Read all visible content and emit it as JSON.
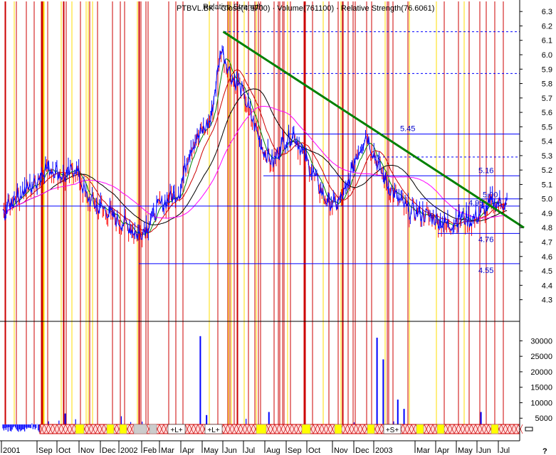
{
  "chart_data": {
    "type": "line",
    "title": "PTBVL.BK - Close(4.9700) · Volume(761100) · Relative Strength(76.6061)",
    "title_overlap_text": "Relative Strength",
    "x_labels": [
      "2001",
      "Sep",
      "Oct",
      "Nov",
      "Dec",
      "2002",
      "Feb",
      "Mar",
      "Apr",
      "May",
      "Jun",
      "Jul",
      "Aug",
      "Sep",
      "Oct",
      "Nov",
      "Dec",
      "2003",
      "Mar",
      "Apr",
      "May",
      "Jun",
      "Jul"
    ],
    "price_axis": {
      "ylim": [
        4.15,
        6.37
      ],
      "ticks": [
        "6.3",
        "6.2",
        "6.1",
        "6.0",
        "5.9",
        "5.8",
        "5.7",
        "5.6",
        "5.5",
        "5.4",
        "5.3",
        "5.2",
        "5.1",
        "5.0",
        "4.9",
        "4.8",
        "4.7",
        "4.6",
        "4.5",
        "4.4",
        "4.3"
      ]
    },
    "volume_axis": {
      "ylim": [
        0,
        34000
      ],
      "ticks": [
        "30000",
        "25000",
        "20000",
        "15000",
        "10000",
        "5000"
      ]
    },
    "grid": false,
    "legend": "none",
    "level_lines": [
      {
        "label": "5.45",
        "value": 5.45
      },
      {
        "label": "5.16",
        "value": 5.16
      },
      {
        "label": "5.00",
        "value": 5.0
      },
      {
        "label": "4.95",
        "value": 4.95
      },
      {
        "label": "4.76",
        "value": 4.76
      },
      {
        "label": "4.55",
        "value": 4.55
      }
    ],
    "dashed_levels": [
      6.16,
      5.87,
      5.29
    ],
    "price_series": {
      "name": "Close",
      "months": [
        0,
        0.5,
        1,
        1.5,
        2,
        2.5,
        3,
        3.5,
        4,
        4.5,
        5,
        5.5,
        6,
        6.5,
        7,
        7.5,
        8,
        8.5,
        9,
        9.5,
        10,
        10.5,
        11,
        11.5,
        12,
        12.5,
        13,
        13.5,
        14,
        14.5,
        15,
        15.5,
        16,
        16.5,
        17,
        17.5,
        18,
        18.5,
        19,
        19.5,
        20,
        20.5,
        21,
        21.5,
        22,
        22.5,
        23,
        23.5
      ],
      "values": [
        4.88,
        5.0,
        5.05,
        5.1,
        5.22,
        5.2,
        5.15,
        5.22,
        5.02,
        4.95,
        4.92,
        4.85,
        4.82,
        4.75,
        4.82,
        4.95,
        5.0,
        5.05,
        5.35,
        5.45,
        5.55,
        6.05,
        5.85,
        5.75,
        5.55,
        5.35,
        5.25,
        5.4,
        5.45,
        5.3,
        5.15,
        5.0,
        4.95,
        5.05,
        5.3,
        5.45,
        5.25,
        5.1,
        5.0,
        4.92,
        4.9,
        4.88,
        4.85,
        4.82,
        4.88,
        4.85,
        4.9,
        4.97
      ]
    },
    "volume_series": {
      "name": "Volume",
      "peaks": [
        {
          "month": 3.0,
          "value": 6500
        },
        {
          "month": 9.5,
          "value": 31500
        },
        {
          "month": 9.8,
          "value": 6000
        },
        {
          "month": 12.8,
          "value": 7000
        },
        {
          "month": 18.0,
          "value": 31000
        },
        {
          "month": 18.3,
          "value": 24000
        },
        {
          "month": 19.0,
          "value": 11000
        },
        {
          "month": 19.3,
          "value": 8000
        },
        {
          "month": 23.0,
          "value": 7000
        }
      ]
    },
    "relative_strength_series": {
      "name": "Relative Strength",
      "months": [
        0,
        1,
        2,
        3,
        4,
        5,
        6,
        7,
        8,
        9,
        10,
        11,
        12,
        13,
        14,
        15,
        16,
        17,
        18,
        19,
        20,
        21,
        22,
        23
      ],
      "values": [
        4.9,
        5.05,
        5.08,
        5.05,
        4.88,
        4.8,
        4.85,
        5.0,
        5.1,
        5.35,
        5.45,
        5.55,
        5.4,
        5.3,
        5.25,
        5.2,
        5.22,
        5.18,
        5.12,
        5.05,
        5.0,
        4.95,
        4.9,
        4.93
      ]
    },
    "signals": [
      "L",
      "L",
      "S"
    ],
    "colors": {
      "price": "#0000ff",
      "down_bars": "#ff0000",
      "trendline": "#008000",
      "vertical_red": "#cc0000",
      "vertical_yellow": "#ffdd00",
      "ma_black": "#000000",
      "ma_red": "#cc0000",
      "ma_green": "#008000",
      "ma_magenta": "#ff00ff",
      "level_line": "#0000ff",
      "annotation_text": "#0000cc"
    }
  }
}
